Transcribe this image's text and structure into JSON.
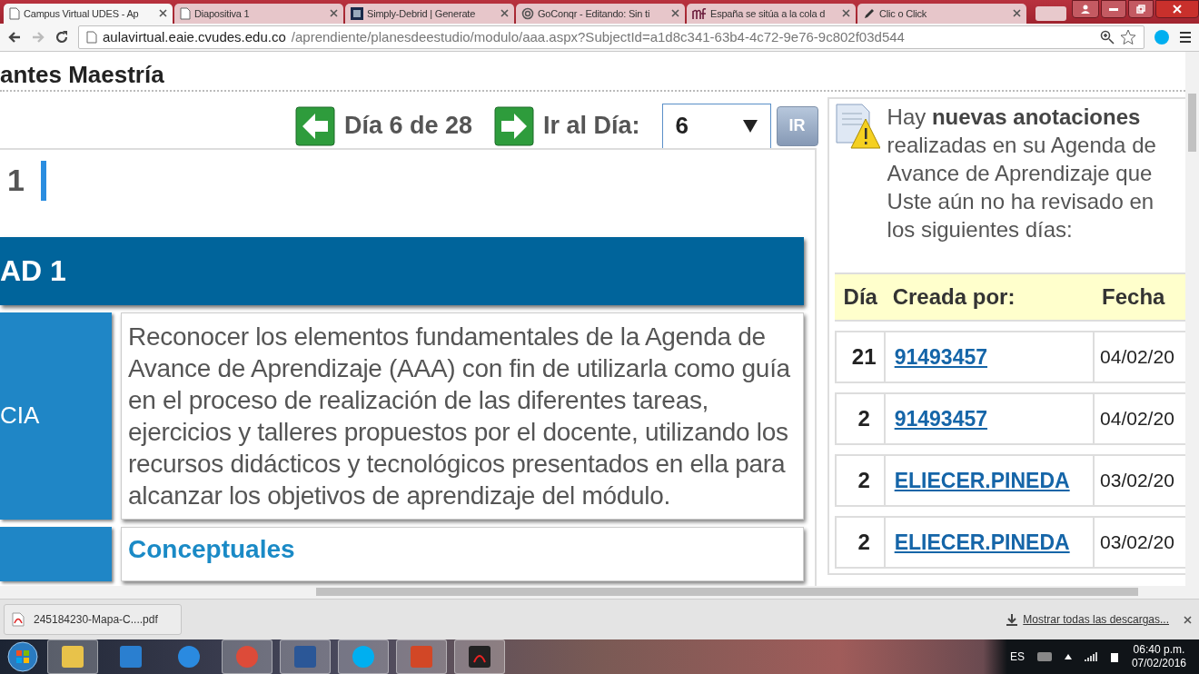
{
  "browser": {
    "tabs": [
      {
        "title": "Campus Virtual UDES - Ap",
        "kind": "page",
        "selected": true
      },
      {
        "title": "Diapositiva 1",
        "kind": "page",
        "selected": false
      },
      {
        "title": "Simply-Debrid | Generate",
        "kind": "sd",
        "selected": false
      },
      {
        "title": "GoConqr - Editando: Sin ti",
        "kind": "swirl",
        "selected": false
      },
      {
        "title": "España se sitúa a la cola d",
        "kind": "mf",
        "selected": false
      },
      {
        "title": "Clic o Click",
        "kind": "pencil",
        "selected": false
      }
    ],
    "url_host": "aulavirtual.eaie.cvudes.edu.co",
    "url_path": "/aprendiente/planesdeestudio/modulo/aaa.aspx?SubjectId=a1d8c341-63b4-4c72-9e76-9c802f03d544"
  },
  "page": {
    "header": "antes Maestría",
    "nav": {
      "day_label": "Día 6 de 28",
      "goto_label": "Ir al Día:",
      "day_value": "6",
      "go_button": "IR"
    },
    "unit_number": "1",
    "unit_banner": "AD 1",
    "rows": [
      {
        "side_label": "CIA",
        "body": "Reconocer los elementos fundamentales de la Agenda de Avance de Aprendizaje (AAA) con fin de utilizarla como guía en el proceso de realización de las diferentes tareas, ejercicios y talleres propuestos por el docente, utilizando los recursos didácticos y tecnológicos presentados en ella para alcanzar los objetivos de aprendizaje del módulo.",
        "kind": "text"
      },
      {
        "body": "Conceptuales",
        "kind": "heading"
      }
    ],
    "notice": {
      "text": "Hay **nuevas anotaciones** realizadas en su Agenda de Avance de Aprendizaje que Uste aún no ha revisado en los siguientes días:",
      "table": {
        "columns": [
          "Día",
          "Creada por:",
          "Fecha"
        ],
        "rows": [
          {
            "day": "21",
            "author": "91493457",
            "date": "04/02/20"
          },
          {
            "day": "2",
            "author": "91493457",
            "date": "04/02/20"
          },
          {
            "day": "2",
            "author": "ELIECER.PINEDA",
            "date": "03/02/20"
          },
          {
            "day": "2",
            "author": "ELIECER.PINEDA",
            "date": "03/02/20"
          }
        ]
      }
    }
  },
  "downloads": {
    "file": "245184230-Mapa-C....pdf",
    "show_all": "Mostrar todas las descargas..."
  },
  "taskbar": {
    "apps": [
      {
        "kind": "explorer",
        "open": true
      },
      {
        "kind": "media",
        "open": false
      },
      {
        "kind": "ie",
        "open": false
      },
      {
        "kind": "chrome",
        "open": true
      },
      {
        "kind": "word",
        "open": true
      },
      {
        "kind": "skype",
        "open": true
      },
      {
        "kind": "powerpoint",
        "open": true
      },
      {
        "kind": "acrobat",
        "open": true
      }
    ],
    "language": "ES",
    "time": "06:40 p.m.",
    "date": "07/02/2016"
  }
}
